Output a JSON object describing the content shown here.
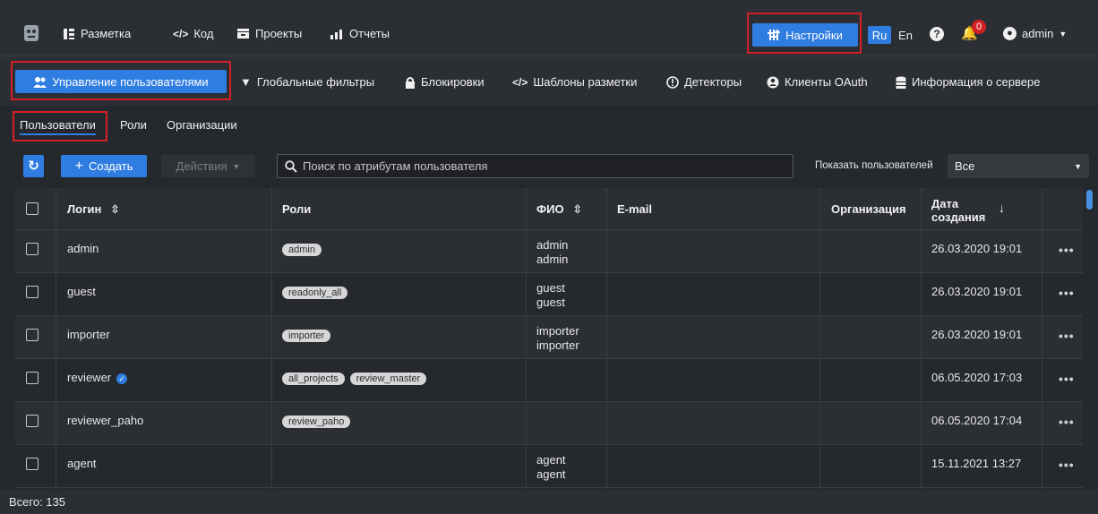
{
  "topbar": {
    "nav": [
      {
        "label": "Разметка",
        "icon": "layout-icon"
      },
      {
        "label": "Код",
        "icon": "code-icon"
      },
      {
        "label": "Проекты",
        "icon": "projects-icon"
      },
      {
        "label": "Отчеты",
        "icon": "reports-icon"
      }
    ],
    "settings_label": "Настройки",
    "lang_ru": "Ru",
    "lang_en": "En",
    "notifications_count": "0",
    "user_label": "admin"
  },
  "subbar": {
    "items": [
      {
        "label": "Управление пользователями",
        "icon": "users-icon"
      },
      {
        "label": "Глобальные фильтры",
        "icon": "filter-icon"
      },
      {
        "label": "Блокировки",
        "icon": "lock-icon"
      },
      {
        "label": "Шаблоны разметки",
        "icon": "code-icon"
      },
      {
        "label": "Детекторы",
        "icon": "detector-icon"
      },
      {
        "label": "Клиенты OAuth",
        "icon": "oauth-icon"
      },
      {
        "label": "Информация о сервере",
        "icon": "server-icon"
      }
    ]
  },
  "tabs": [
    "Пользователи",
    "Роли",
    "Организации"
  ],
  "toolbar": {
    "create_label": "Создать",
    "actions_label": "Действия",
    "search_placeholder": "Поиск по атрибутам пользователя",
    "show_users_label": "Показать пользователей",
    "show_users_value": "Все"
  },
  "table": {
    "headers": {
      "login": "Логин",
      "roles": "Роли",
      "fio": "ФИО",
      "email": "E-mail",
      "org": "Организация",
      "created": "Дата создания"
    },
    "rows": [
      {
        "login": "admin",
        "roles": [
          "admin"
        ],
        "fio": [
          "admin",
          "admin"
        ],
        "email": "",
        "org": "",
        "created": "26.03.2020 19:01",
        "verified": false
      },
      {
        "login": "guest",
        "roles": [
          "readonly_all"
        ],
        "fio": [
          "guest",
          "guest"
        ],
        "email": "",
        "org": "",
        "created": "26.03.2020 19:01",
        "verified": false
      },
      {
        "login": "importer",
        "roles": [
          "importer"
        ],
        "fio": [
          "importer",
          "importer"
        ],
        "email": "",
        "org": "",
        "created": "26.03.2020 19:01",
        "verified": false
      },
      {
        "login": "reviewer",
        "roles": [
          "all_projects",
          "review_master"
        ],
        "fio": [],
        "email": "",
        "org": "",
        "created": "06.05.2020 17:03",
        "verified": true
      },
      {
        "login": "reviewer_paho",
        "roles": [
          "review_paho"
        ],
        "fio": [],
        "email": "",
        "org": "",
        "created": "06.05.2020 17:04",
        "verified": false
      },
      {
        "login": "agent",
        "roles": [],
        "fio": [
          "agent",
          "agent"
        ],
        "email": "",
        "org": "",
        "created": "15.11.2021 13:27",
        "verified": false
      }
    ]
  },
  "footer": {
    "total_label": "Всего: 135"
  }
}
